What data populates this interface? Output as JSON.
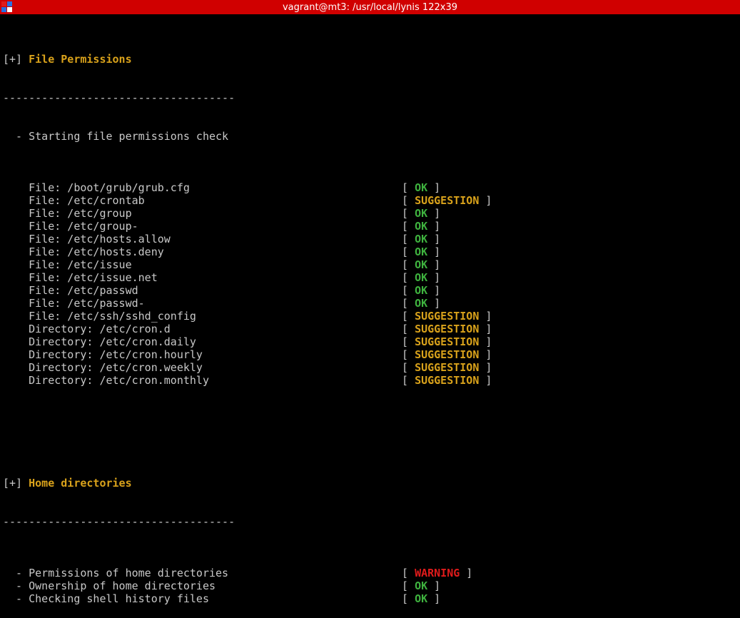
{
  "window": {
    "title": "vagrant@mt3: /usr/local/lynis 122x39"
  },
  "colors": {
    "ok": "#3fb33f",
    "suggestion": "#d9a21b",
    "warning": "#e01b1b",
    "header": "#d9a21b",
    "titlebar": "#d00000"
  },
  "sections": [
    {
      "marker": "[+]",
      "title": "File Permissions",
      "separator": "------------------------------------",
      "intro": "  - Starting file permissions check",
      "items": [
        {
          "text": "    File: /boot/grub/grub.cfg",
          "status": "OK",
          "kind": "ok"
        },
        {
          "text": "    File: /etc/crontab",
          "status": "SUGGESTION",
          "kind": "sugg"
        },
        {
          "text": "    File: /etc/group",
          "status": "OK",
          "kind": "ok"
        },
        {
          "text": "    File: /etc/group-",
          "status": "OK",
          "kind": "ok"
        },
        {
          "text": "    File: /etc/hosts.allow",
          "status": "OK",
          "kind": "ok"
        },
        {
          "text": "    File: /etc/hosts.deny",
          "status": "OK",
          "kind": "ok"
        },
        {
          "text": "    File: /etc/issue",
          "status": "OK",
          "kind": "ok"
        },
        {
          "text": "    File: /etc/issue.net",
          "status": "OK",
          "kind": "ok"
        },
        {
          "text": "    File: /etc/passwd",
          "status": "OK",
          "kind": "ok"
        },
        {
          "text": "    File: /etc/passwd-",
          "status": "OK",
          "kind": "ok"
        },
        {
          "text": "    File: /etc/ssh/sshd_config",
          "status": "SUGGESTION",
          "kind": "sugg"
        },
        {
          "text": "    Directory: /etc/cron.d",
          "status": "SUGGESTION",
          "kind": "sugg"
        },
        {
          "text": "    Directory: /etc/cron.daily",
          "status": "SUGGESTION",
          "kind": "sugg"
        },
        {
          "text": "    Directory: /etc/cron.hourly",
          "status": "SUGGESTION",
          "kind": "sugg"
        },
        {
          "text": "    Directory: /etc/cron.weekly",
          "status": "SUGGESTION",
          "kind": "sugg"
        },
        {
          "text": "    Directory: /etc/cron.monthly",
          "status": "SUGGESTION",
          "kind": "sugg"
        }
      ]
    },
    {
      "marker": "[+]",
      "title": "Home directories",
      "separator": "------------------------------------",
      "items": [
        {
          "text": "  - Permissions of home directories",
          "status": "WARNING",
          "kind": "warn"
        },
        {
          "text": "  - Ownership of home directories",
          "status": "OK",
          "kind": "ok"
        },
        {
          "text": "  - Checking shell history files",
          "status": "OK",
          "kind": "ok"
        }
      ]
    }
  ]
}
